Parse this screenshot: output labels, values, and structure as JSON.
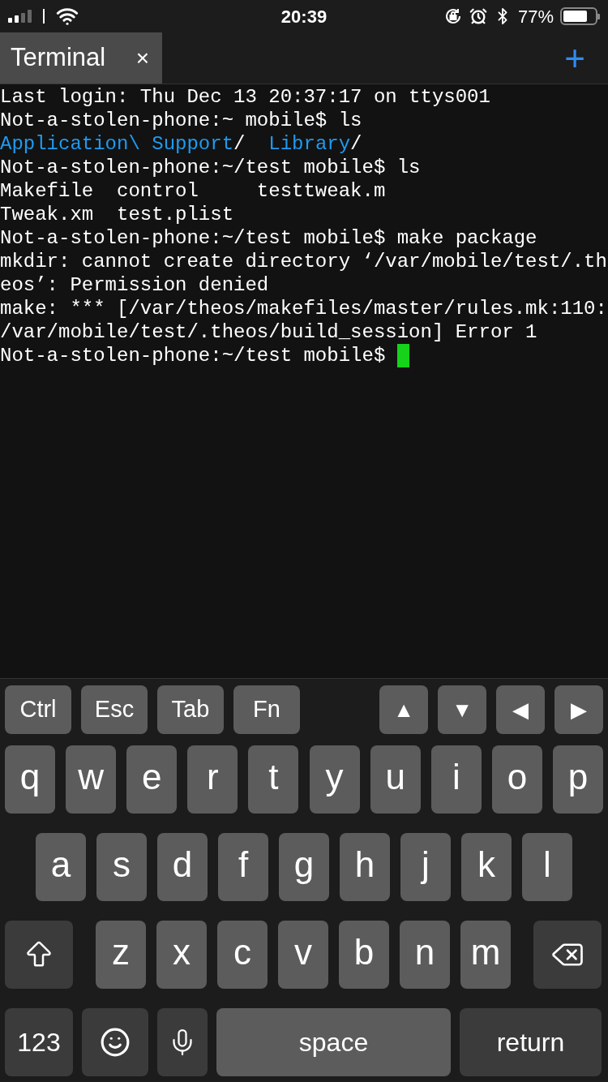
{
  "status_bar": {
    "time": "20:39",
    "battery_percent": "77%"
  },
  "tabs": [
    {
      "label": "Terminal",
      "selected": true,
      "close": "×"
    }
  ],
  "new_tab": "+",
  "terminal": {
    "lines": [
      [
        {
          "text": "Last login: Thu Dec 13 20:37:17 on ttys001",
          "kind": "plain"
        }
      ],
      [
        {
          "text": "Not-a-stolen-phone:~ mobile$ ls",
          "kind": "plain"
        }
      ],
      [
        {
          "text": "Application\\ Support",
          "kind": "dir"
        },
        {
          "text": "/  ",
          "kind": "plain"
        },
        {
          "text": "Library",
          "kind": "dir"
        },
        {
          "text": "/",
          "kind": "plain"
        }
      ],
      [
        {
          "text": "Not-a-stolen-phone:~/test mobile$ ls",
          "kind": "plain"
        }
      ],
      [
        {
          "text": "Makefile  control     testtweak.m",
          "kind": "plain"
        }
      ],
      [
        {
          "text": "Tweak.xm  test.plist",
          "kind": "plain"
        }
      ],
      [
        {
          "text": "Not-a-stolen-phone:~/test mobile$ make package",
          "kind": "plain"
        }
      ],
      [
        {
          "text": "mkdir: cannot create directory ‘/var/mobile/test/.th",
          "kind": "plain"
        }
      ],
      [
        {
          "text": "eos’: Permission denied",
          "kind": "plain"
        }
      ],
      [
        {
          "text": "make: *** [/var/theos/makefiles/master/rules.mk:110:",
          "kind": "plain"
        }
      ],
      [
        {
          "text": "/var/mobile/test/.theos/build_session] Error 1",
          "kind": "plain"
        }
      ],
      [
        {
          "text": "Not-a-stolen-phone:~/test mobile$ ",
          "kind": "plain"
        },
        {
          "kind": "cursor"
        }
      ]
    ]
  },
  "accessory_keys": [
    {
      "label": "Ctrl"
    },
    {
      "label": "Esc"
    },
    {
      "label": "Tab"
    },
    {
      "label": "Fn"
    }
  ],
  "arrow_keys": [
    {
      "label": "▲"
    },
    {
      "label": "▼"
    },
    {
      "label": "◀"
    },
    {
      "label": "▶"
    }
  ],
  "keyboard_rows": [
    [
      {
        "label": "q",
        "kind": "letter"
      },
      {
        "label": "w",
        "kind": "letter"
      },
      {
        "label": "e",
        "kind": "letter"
      },
      {
        "label": "r",
        "kind": "letter"
      },
      {
        "label": "t",
        "kind": "letter"
      },
      {
        "label": "y",
        "kind": "letter"
      },
      {
        "label": "u",
        "kind": "letter"
      },
      {
        "label": "i",
        "kind": "letter"
      },
      {
        "label": "o",
        "kind": "letter"
      },
      {
        "label": "p",
        "kind": "letter"
      }
    ],
    [
      {
        "label": "a",
        "kind": "letter"
      },
      {
        "label": "s",
        "kind": "letter"
      },
      {
        "label": "d",
        "kind": "letter"
      },
      {
        "label": "f",
        "kind": "letter"
      },
      {
        "label": "g",
        "kind": "letter"
      },
      {
        "label": "h",
        "kind": "letter"
      },
      {
        "label": "j",
        "kind": "letter"
      },
      {
        "label": "k",
        "kind": "letter"
      },
      {
        "label": "l",
        "kind": "letter"
      }
    ],
    [
      {
        "kind": "shift"
      },
      {
        "label": "z",
        "kind": "letter"
      },
      {
        "label": "x",
        "kind": "letter"
      },
      {
        "label": "c",
        "kind": "letter"
      },
      {
        "label": "v",
        "kind": "letter"
      },
      {
        "label": "b",
        "kind": "letter"
      },
      {
        "label": "n",
        "kind": "letter"
      },
      {
        "label": "m",
        "kind": "letter"
      },
      {
        "kind": "backspace"
      }
    ],
    [
      {
        "label": "123",
        "kind": "numbers"
      },
      {
        "kind": "emoji"
      },
      {
        "kind": "mic"
      },
      {
        "label": "space",
        "kind": "space"
      },
      {
        "label": "return",
        "kind": "return"
      }
    ]
  ]
}
